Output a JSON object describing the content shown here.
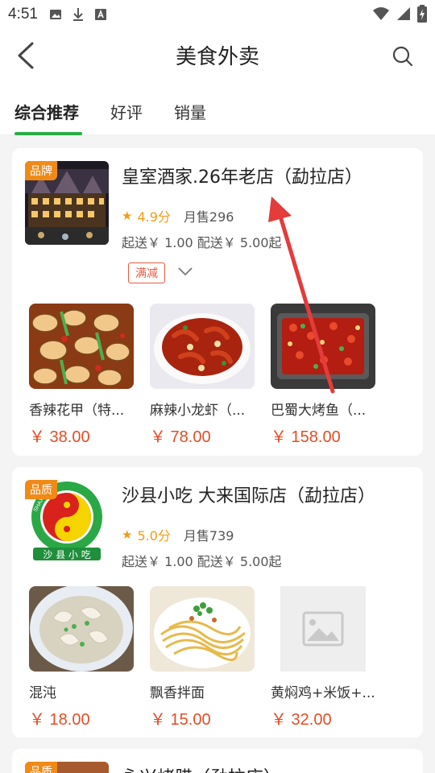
{
  "status": {
    "time": "4:51"
  },
  "header": {
    "title": "美食外卖"
  },
  "tabs": [
    {
      "label": "综合推荐"
    },
    {
      "label": "好评"
    },
    {
      "label": "销量"
    }
  ],
  "shops": [
    {
      "badge": "品牌",
      "name": "皇室酒家.26年老店（勐拉店）",
      "rating": "4.9分",
      "sales": "月售296",
      "fees": "起送￥ 1.00  配送￥ 5.00起",
      "promo": "满减",
      "dishes": [
        {
          "name": "香辣花甲（特...",
          "price": "￥ 38.00"
        },
        {
          "name": "麻辣小龙虾（...",
          "price": "￥ 78.00"
        },
        {
          "name": "巴蜀大烤鱼（...",
          "price": "￥ 158.00"
        }
      ]
    },
    {
      "badge": "品质",
      "name": "沙县小吃 大来国际店（勐拉店）",
      "rating": "5.0分",
      "sales": "月售739",
      "fees": "起送￥ 1.00  配送￥ 5.00起",
      "logo_arc_text": "SHAXIAN DELICACIES",
      "logo_text": "沙 县 小 吃",
      "dishes": [
        {
          "name": "混沌",
          "price": "￥ 18.00"
        },
        {
          "name": "飘香拌面",
          "price": "￥ 15.00"
        },
        {
          "name": "黄焖鸡+米饭+...",
          "price": "￥ 32.00"
        }
      ]
    },
    {
      "badge": "品质",
      "name": "永兴烤腊（勐拉店）"
    }
  ],
  "colors": {
    "accent": "#27ae43",
    "price": "#e44d26",
    "rating": "#f39c12",
    "badge": "#f08a17",
    "annotation_arrow": "#e43b3b"
  }
}
